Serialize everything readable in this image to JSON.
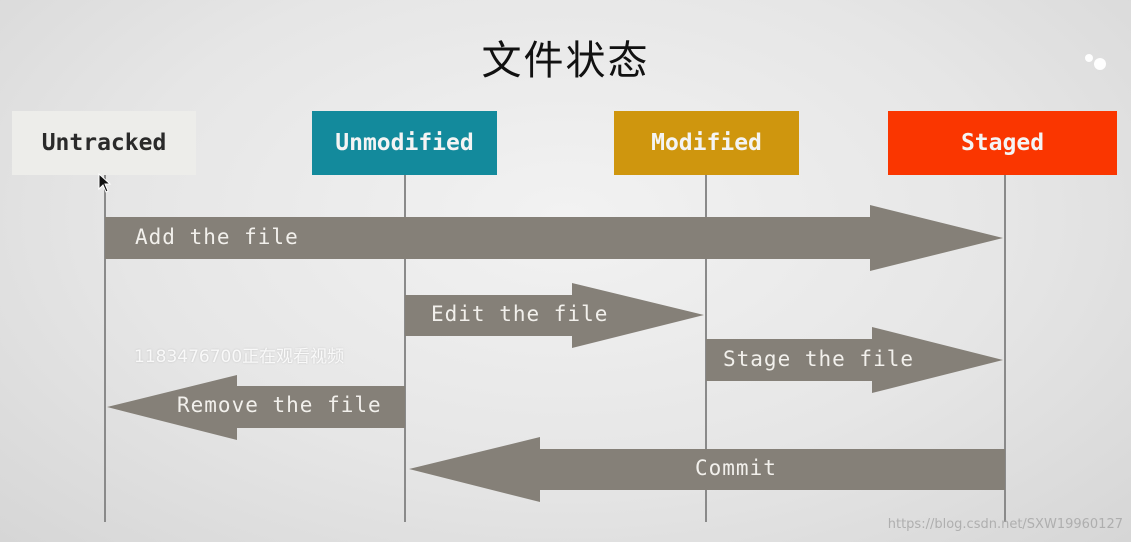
{
  "title": "文件状态",
  "states": [
    {
      "label": "Untracked",
      "color": "#ededea"
    },
    {
      "label": "Unmodified",
      "color": "#138a9c"
    },
    {
      "label": "Modified",
      "color": "#cf960e"
    },
    {
      "label": "Staged",
      "color": "#fa3600"
    }
  ],
  "transitions": [
    {
      "label": "Add the file",
      "from": "Untracked",
      "to": "Staged"
    },
    {
      "label": "Edit the file",
      "from": "Unmodified",
      "to": "Modified"
    },
    {
      "label": "Stage the file",
      "from": "Modified",
      "to": "Staged"
    },
    {
      "label": "Remove the file",
      "from": "Unmodified",
      "to": "Untracked"
    },
    {
      "label": "Commit",
      "from": "Staged",
      "to": "Unmodified"
    }
  ],
  "arrow_color": "#858078",
  "overlay_text": "1183476700正在观看视频",
  "source_text": "https://blog.csdn.net/SXW19960127"
}
